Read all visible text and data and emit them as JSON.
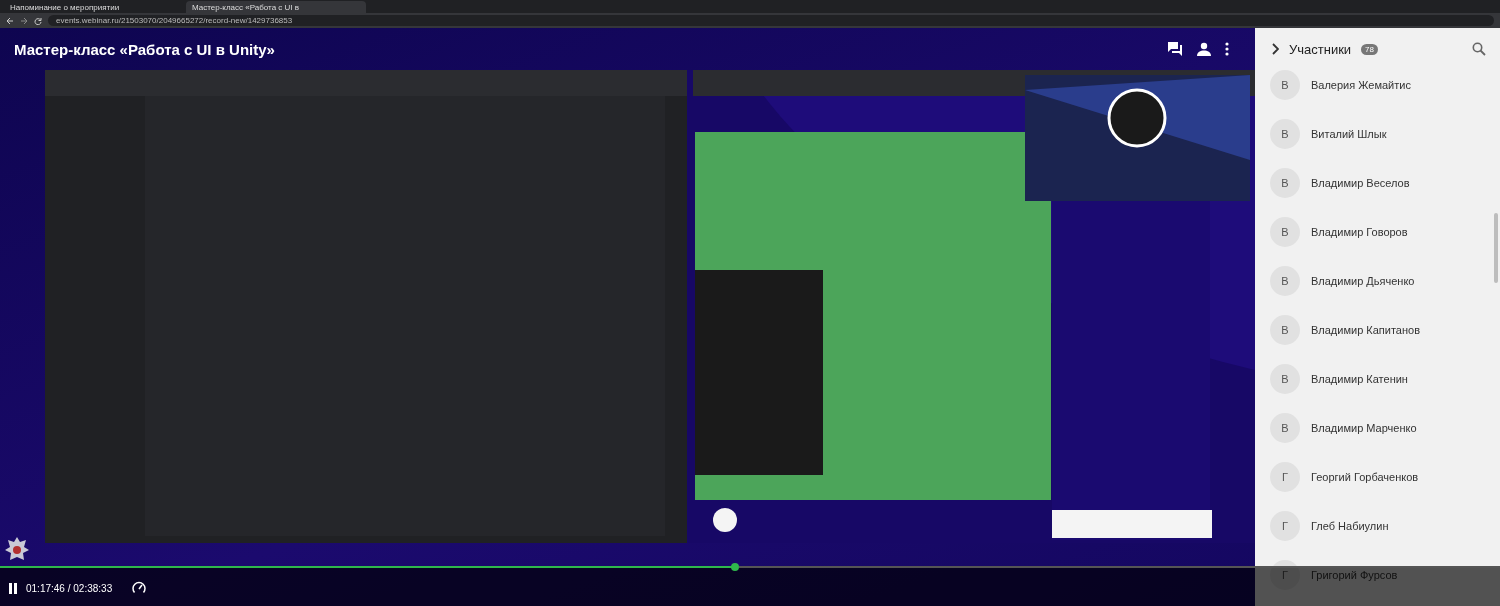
{
  "browser": {
    "tabs": [
      {
        "label": "Напоминание о мероприятии",
        "selected": false
      },
      {
        "label": "Мастер-класс «Работа с UI в",
        "selected": true
      }
    ],
    "url": "events.webinar.ru/21503070/2049665272/record-new/1429736853"
  },
  "header": {
    "title": "Мастер-класс «Работа с UI в Unity»"
  },
  "participants": {
    "title": "Участники",
    "count": "78",
    "items": [
      {
        "initial": "В",
        "name": "Валерия Жемайтис"
      },
      {
        "initial": "В",
        "name": "Виталий Шлык"
      },
      {
        "initial": "В",
        "name": "Владимир Веселов"
      },
      {
        "initial": "В",
        "name": "Владимир Говоров"
      },
      {
        "initial": "В",
        "name": "Владимир Дьяченко"
      },
      {
        "initial": "В",
        "name": "Владимир Капитанов"
      },
      {
        "initial": "В",
        "name": "Владимир Катенин"
      },
      {
        "initial": "В",
        "name": "Владимир Марченко"
      },
      {
        "initial": "Г",
        "name": "Георгий Горбаченков"
      },
      {
        "initial": "Г",
        "name": "Глеб Набиулин"
      },
      {
        "initial": "Г",
        "name": "Григорий Фурсов"
      }
    ]
  },
  "player": {
    "playing": true,
    "level": 0.49,
    "time": "01:17:46 / 02:38:33"
  }
}
